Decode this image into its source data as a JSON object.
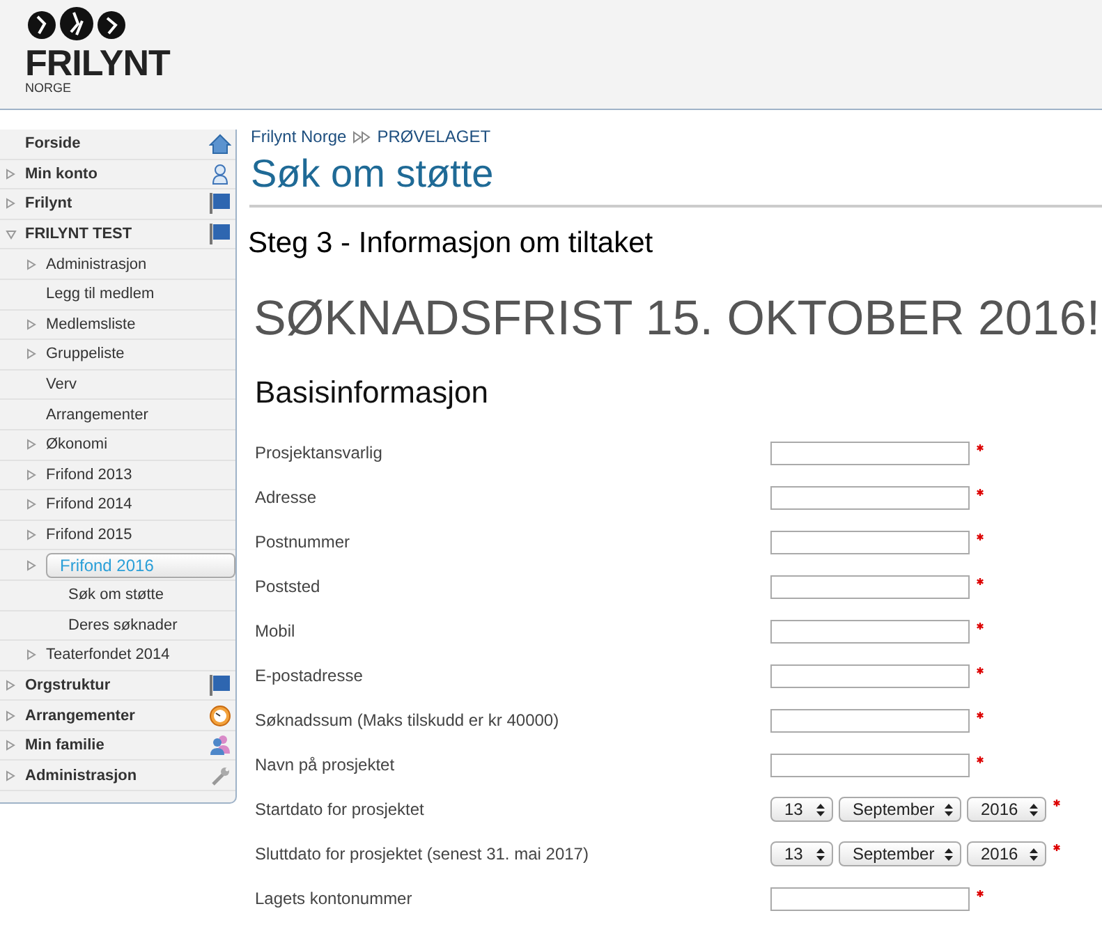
{
  "logo": {
    "name": "FRILYNT",
    "subtitle": "NORGE"
  },
  "sidebar": {
    "items": [
      {
        "label": "Forside",
        "kind": "leaf",
        "selected": false
      },
      {
        "label": "Min konto",
        "kind": "collapsed",
        "selected": false
      },
      {
        "label": "Frilynt",
        "kind": "collapsed",
        "selected": false
      },
      {
        "label": "FRILYNT TEST",
        "kind": "expanded",
        "selected": false,
        "children": [
          {
            "label": "Administrasjon",
            "kind": "collapsed",
            "selected": false
          },
          {
            "label": "Legg til medlem",
            "kind": "leaf",
            "selected": false
          },
          {
            "label": "Medlemsliste",
            "kind": "collapsed",
            "selected": false
          },
          {
            "label": "Gruppeliste",
            "kind": "collapsed",
            "selected": false
          },
          {
            "label": "Verv",
            "kind": "leaf",
            "selected": false
          },
          {
            "label": "Arrangementer",
            "kind": "leaf",
            "selected": false
          },
          {
            "label": "Økonomi",
            "kind": "collapsed",
            "selected": false
          },
          {
            "label": "Frifond 2013",
            "kind": "collapsed",
            "selected": false
          },
          {
            "label": "Frifond 2014",
            "kind": "collapsed",
            "selected": false
          },
          {
            "label": "Frifond 2015",
            "kind": "collapsed",
            "selected": false
          },
          {
            "label": "Frifond 2016",
            "kind": "collapsed",
            "selected": true,
            "children": [
              {
                "label": "Søk om støtte",
                "selected": false
              },
              {
                "label": "Deres søknader",
                "selected": false
              }
            ]
          },
          {
            "label": "Teaterfondet 2014",
            "kind": "collapsed",
            "selected": false
          }
        ]
      },
      {
        "label": "Orgstruktur",
        "kind": "collapsed",
        "selected": false
      },
      {
        "label": "Arrangementer",
        "kind": "collapsed",
        "selected": false
      },
      {
        "label": "Min familie",
        "kind": "collapsed",
        "selected": false
      },
      {
        "label": "Administrasjon",
        "kind": "collapsed",
        "selected": false
      }
    ]
  },
  "breadcrumb": [
    {
      "label": "Frilynt Norge"
    },
    {
      "label": "PRØVELAGET"
    }
  ],
  "page_title": "Søk om støtte",
  "step_title": "Steg 3 - Informasjon om tiltaket",
  "deadline": "SØKNADSFRIST 15. OKTOBER 2016!",
  "section_title": "Basisinformasjon",
  "fields": [
    {
      "label": "Prosjektansvarlig",
      "kind": "text",
      "required": true
    },
    {
      "label": "Adresse",
      "kind": "text",
      "required": true
    },
    {
      "label": "Postnummer",
      "kind": "text",
      "required": true
    },
    {
      "label": "Poststed",
      "kind": "text",
      "required": true
    },
    {
      "label": "Mobil",
      "kind": "text",
      "required": true
    },
    {
      "label": "E-postadresse",
      "kind": "text",
      "required": true
    },
    {
      "label": "Søknadssum (Maks tilskudd er kr 40000)",
      "kind": "text",
      "required": true
    },
    {
      "label": "Navn på prosjektet",
      "kind": "text",
      "required": true
    },
    {
      "label": "Startdato for prosjektet",
      "kind": "date",
      "day": "13",
      "month": "September",
      "year": "2016",
      "required": true
    },
    {
      "label": "Sluttdato for prosjektet (senest 31. mai 2017)",
      "kind": "date",
      "day": "13",
      "month": "September",
      "year": "2016",
      "required": true
    },
    {
      "label": "Lagets kontonummer",
      "kind": "text",
      "required": true
    }
  ]
}
